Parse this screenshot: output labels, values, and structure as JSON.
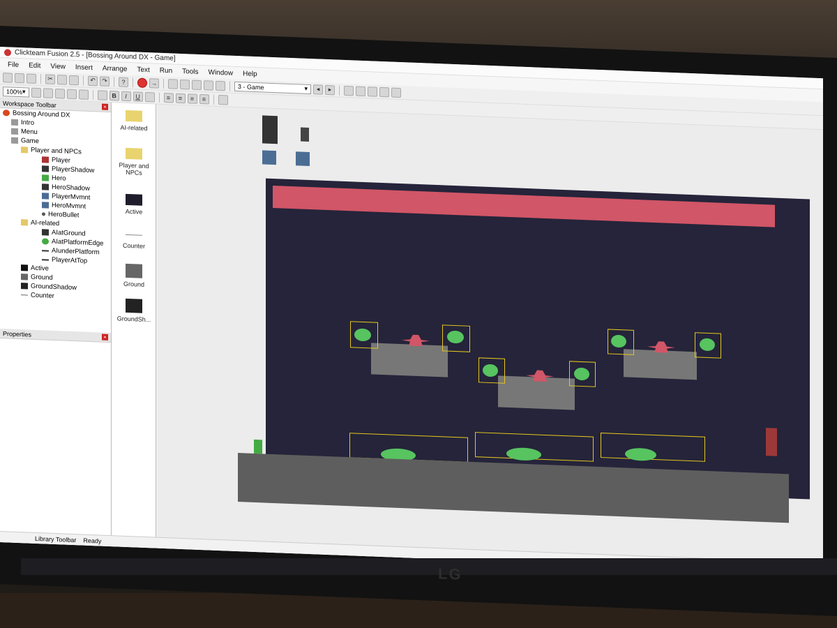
{
  "window": {
    "title": "Clickteam Fusion 2.5 - [Bossing Around DX - Game]"
  },
  "menu": [
    "File",
    "Edit",
    "View",
    "Insert",
    "Arrange",
    "Text",
    "Run",
    "Tools",
    "Window",
    "Help"
  ],
  "toolbar": {
    "zoom": "100%",
    "frame_selector": "3 - Game",
    "bold": "B",
    "italic": "I",
    "underline": "U"
  },
  "workspace": {
    "title": "Workspace Toolbar",
    "tree": [
      {
        "label": "Bossing Around DX",
        "level": 0
      },
      {
        "label": "Intro",
        "level": 1
      },
      {
        "label": "Menu",
        "level": 1
      },
      {
        "label": "Game",
        "level": 1
      },
      {
        "label": "Player and NPCs",
        "level": 2
      },
      {
        "label": "Player",
        "level": 3
      },
      {
        "label": "PlayerShadow",
        "level": 3
      },
      {
        "label": "Hero",
        "level": 3
      },
      {
        "label": "HeroShadow",
        "level": 3
      },
      {
        "label": "PlayerMvmnt",
        "level": 3
      },
      {
        "label": "HeroMvmnt",
        "level": 3
      },
      {
        "label": "HeroBullet",
        "level": 3
      },
      {
        "label": "AI-related",
        "level": 2
      },
      {
        "label": "AIatGround",
        "level": 3
      },
      {
        "label": "AIatPlatformEdge",
        "level": 3
      },
      {
        "label": "AIunderPlatform",
        "level": 3
      },
      {
        "label": "PlayerAtTop",
        "level": 3
      },
      {
        "label": "Active",
        "level": 2
      },
      {
        "label": "Ground",
        "level": 2
      },
      {
        "label": "GroundShadow",
        "level": 2
      },
      {
        "label": "Counter",
        "level": 2
      }
    ]
  },
  "properties": {
    "title": "Properties"
  },
  "objects": [
    {
      "label": "AI-related",
      "kind": "folder-icon"
    },
    {
      "label": "Player and NPCs",
      "kind": "folder-icon"
    },
    {
      "label": "Active",
      "kind": "active-icon"
    },
    {
      "label": "Counter",
      "kind": "counter-icon"
    },
    {
      "label": "Ground",
      "kind": "ground-icon"
    },
    {
      "label": "GroundSh...",
      "kind": "ground-shadow-icon"
    }
  ],
  "library": {
    "title": "Library Toolbar"
  },
  "status": {
    "text": "Ready"
  },
  "colors": {
    "hud": "#d15667",
    "background": "#25243a",
    "bush": "#57c460",
    "selection": "#e6c81e",
    "enemy": "#d15667"
  },
  "monitor": {
    "brand": "LG"
  }
}
